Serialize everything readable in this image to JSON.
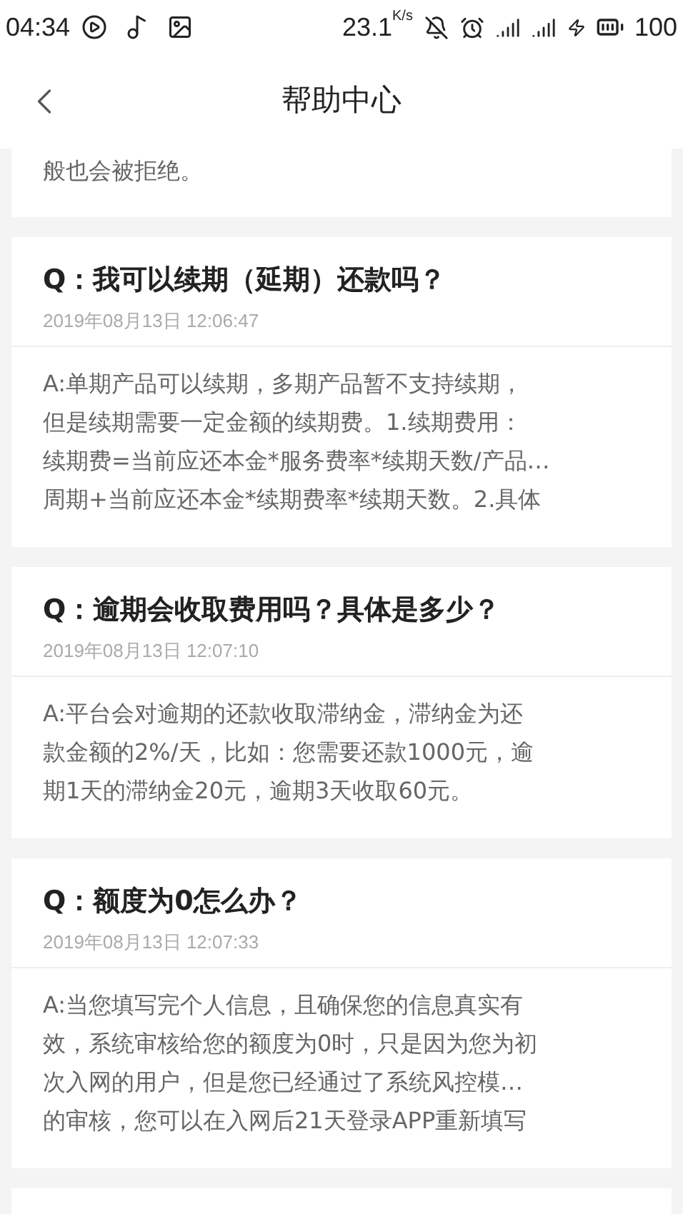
{
  "status_bar": {
    "time": "04:34",
    "speed": "23.1",
    "speed_unit": "K/s",
    "battery": "100"
  },
  "header": {
    "title": "帮助中心"
  },
  "faq_top_fragment": "般也会被拒绝。",
  "faqs": [
    {
      "question": "Q：我可以续期（延期）还款吗？",
      "date": "2019年08月13日 12:06:47",
      "answer_lines": [
        "A:单期产品可以续期，多期产品暂不支持续期，",
        "但是续期需要一定金额的续期费。1.续期费用：",
        "续期费=当前应还本金*服务费率*续期天数/产品…",
        "周期+当前应还本金*续期费率*续期天数。2.具体"
      ]
    },
    {
      "question": "Q：逾期会收取费用吗？具体是多少？",
      "date": "2019年08月13日 12:07:10",
      "answer_lines": [
        "A:平台会对逾期的还款收取滞纳金，滞纳金为还",
        "款金额的2%/天，比如：您需要还款1000元，逾",
        "期1天的滞纳金20元，逾期3天收取60元。"
      ]
    },
    {
      "question": "Q：额度为0怎么办？",
      "date": "2019年08月13日 12:07:33",
      "answer_lines": [
        "A:当您填写完个人信息，且确保您的信息真实有",
        "效，系统审核给您的额度为0时，只是因为您为初",
        "次入网的用户，但是您已经通过了系统风控模…",
        "的审核，您可以在入网后21天登录APP重新填写"
      ]
    }
  ]
}
